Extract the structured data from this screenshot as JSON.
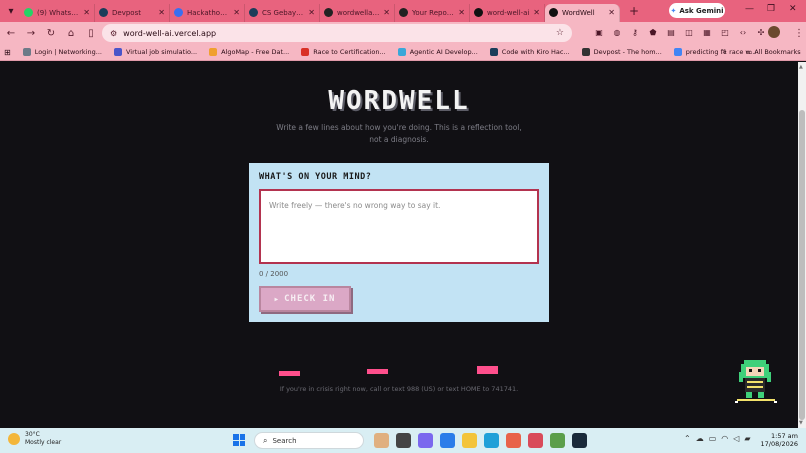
{
  "browser": {
    "tabs": [
      {
        "label": "(9) WhatsApp",
        "icon": "whatsapp-icon",
        "color": "#25d366",
        "active": false
      },
      {
        "label": "Devpost",
        "icon": "devpost-icon",
        "color": "#1c3d5a",
        "active": false
      },
      {
        "label": "Hackathon Ide",
        "icon": "cursor-icon",
        "color": "#3a6ff0",
        "active": false
      },
      {
        "label": "CS Gebay Aid",
        "icon": "devpost-icon",
        "color": "#1c3d5a",
        "active": false
      },
      {
        "label": "wordwellai (i)",
        "icon": "github-icon",
        "color": "#222222",
        "active": false
      },
      {
        "label": "Your Repositor",
        "icon": "github-icon",
        "color": "#222222",
        "active": false
      },
      {
        "label": "word-well-ai",
        "icon": "vercel-icon",
        "color": "#111111",
        "active": false
      },
      {
        "label": "WordWell",
        "icon": "wordwell-icon",
        "color": "#111111",
        "active": true
      }
    ],
    "ask_gemini": "Ask Gemini",
    "url": "word-well-ai.vercel.app",
    "bookmarks": [
      {
        "label": "Login | Networking...",
        "color": "#6d7a88"
      },
      {
        "label": "Virtual job simulatio...",
        "color": "#4a55c9"
      },
      {
        "label": "AlgoMap - Free Dat...",
        "color": "#f0a030"
      },
      {
        "label": "Race to Certification...",
        "color": "#d93025"
      },
      {
        "label": "Agentic AI Develop...",
        "color": "#3aa7d8"
      },
      {
        "label": "Code with Kiro Hac...",
        "color": "#1c3d5a"
      },
      {
        "label": "Devpost - The hom...",
        "color": "#333333"
      },
      {
        "label": "predicting f1 race w...",
        "color": "#4285f4"
      }
    ],
    "all_bookmarks": "All Bookmarks"
  },
  "app": {
    "logo": "WORDWELL",
    "subtitle": "Write a few lines about how you're doing. This is a reflection tool, not a diagnosis.",
    "prompt_title": "WHAT'S ON YOUR MIND?",
    "textarea_placeholder": "Write freely — there's no wrong way to say it.",
    "char_count": "0 / 2000",
    "checkin_label": "CHECK IN",
    "crisis_note": "If you're in crisis right now, call or text 988 (US) or text HOME to 741741.",
    "accent_color": "#ff4f8c",
    "card_color": "#c2e3f4"
  },
  "taskbar": {
    "weather_temp": "30°C",
    "weather_desc": "Mostly clear",
    "search_label": "Search",
    "time": "1:57 am",
    "date": "17/08/2026"
  }
}
